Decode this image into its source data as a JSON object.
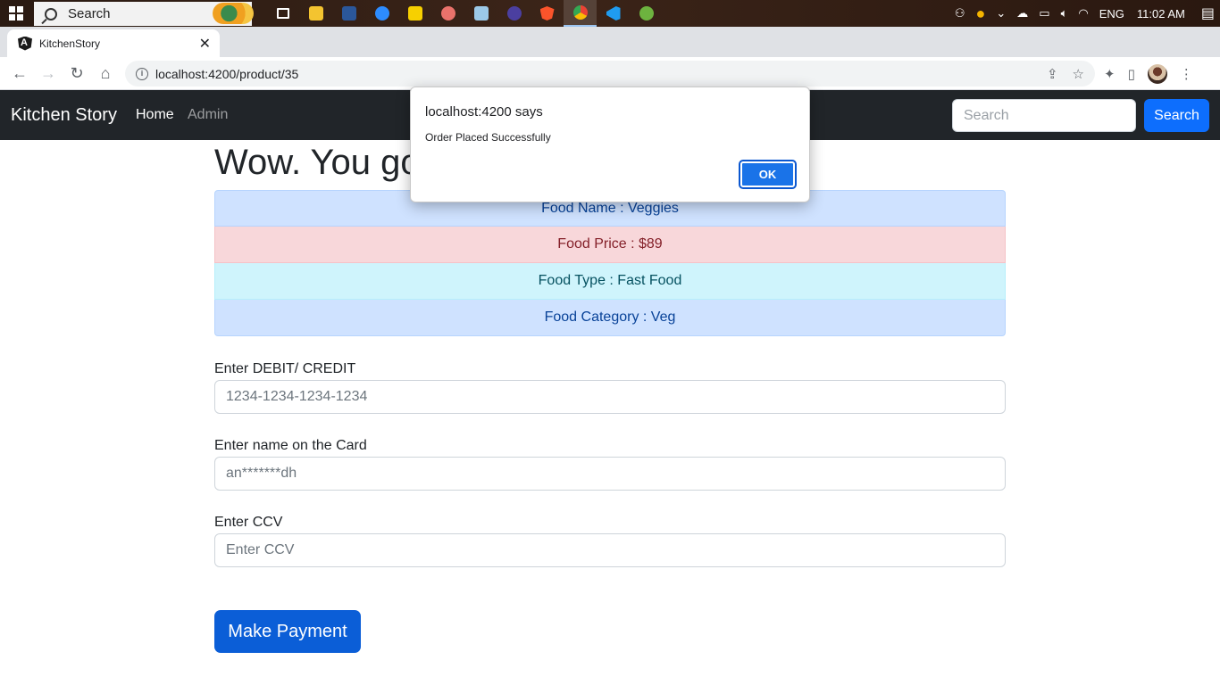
{
  "taskbar": {
    "search_label": "Search",
    "apps": [
      "task-view",
      "file-explorer",
      "word",
      "zoom",
      "sticky-notes",
      "paint",
      "notepad",
      "media-app",
      "brave",
      "chrome",
      "vscode",
      "spring-tool"
    ],
    "language": "ENG",
    "time": "11:02 AM"
  },
  "browser": {
    "tab_title": "KitchenStory",
    "new_tab": "+",
    "url": "localhost:4200/product/35"
  },
  "navbar": {
    "brand": "Kitchen Story",
    "links": [
      "Home",
      "Admin"
    ],
    "search_placeholder": "Search",
    "search_button": "Search"
  },
  "page": {
    "heading": "Wow. You go",
    "food": {
      "name": "Food Name : Veggies",
      "price": "Food Price : $89",
      "type": "Food Type : Fast Food",
      "category": "Food Category : Veg"
    },
    "form": {
      "card_label": "Enter DEBIT/ CREDIT",
      "card_placeholder": "1234-1234-1234-1234",
      "name_label": "Enter name on the Card",
      "name_placeholder": "an*******dh",
      "ccv_label": "Enter CCV",
      "ccv_placeholder": "Enter CCV"
    },
    "pay_button": "Make Payment"
  },
  "dialog": {
    "title": "localhost:4200 says",
    "message": "Order Placed Successfully",
    "ok": "OK"
  },
  "colors": {
    "navbar_bg": "#212529",
    "primary": "#0d6efd",
    "dialog_ok": "#1a73e8"
  }
}
